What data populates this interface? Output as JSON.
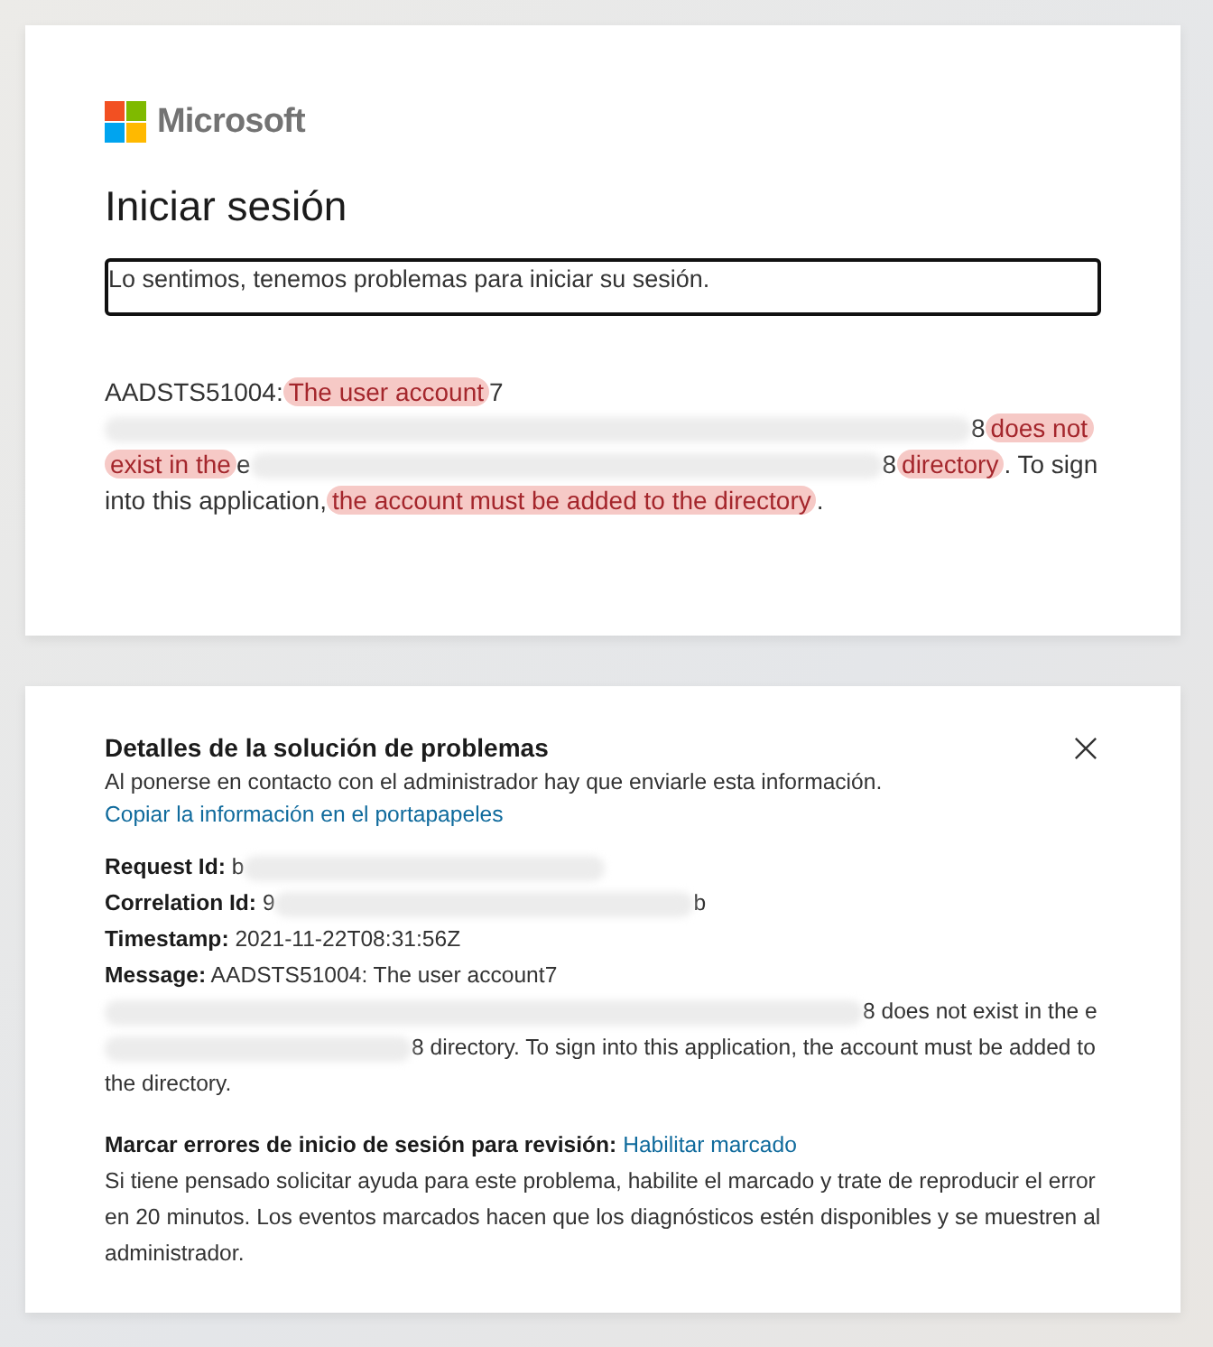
{
  "signin_card": {
    "logo_text": "Microsoft",
    "title": "Iniciar sesión",
    "alert": "Lo sentimos, tenemos problemas para iniciar su sesión.",
    "message": [
      {
        "kind": "plain",
        "text": "AADSTS51004:"
      },
      {
        "kind": "highlight",
        "text": "The user account"
      },
      {
        "kind": "plain",
        "text": "7"
      },
      {
        "kind": "redacted"
      },
      {
        "kind": "plain",
        "text": "8"
      },
      {
        "kind": "highlight",
        "text": "does not exist in the"
      },
      {
        "kind": "plain",
        "text": "e"
      },
      {
        "kind": "redacted"
      },
      {
        "kind": "plain",
        "text": "8"
      },
      {
        "kind": "highlight",
        "text": "directory"
      },
      {
        "kind": "plain",
        "text": ". To sign into this application,"
      },
      {
        "kind": "highlight",
        "text": "the account must be added to the directory"
      },
      {
        "kind": "plain",
        "text": "."
      }
    ]
  },
  "details_card": {
    "title": "Detalles de la solución de problemas",
    "subtitle": "Al ponerse en contacto con el administrador hay que enviarle esta información.",
    "copy_link": "Copiar la información en el portapapeles",
    "fields": [
      {
        "label": "Request Id:",
        "value": [
          {
            "kind": "plain",
            "text": "b"
          },
          {
            "kind": "redacted"
          }
        ]
      },
      {
        "label": "Correlation Id:",
        "value": [
          {
            "kind": "plain",
            "text": "9"
          },
          {
            "kind": "redacted"
          },
          {
            "kind": "plain",
            "text": "b"
          }
        ]
      },
      {
        "label": "Timestamp:",
        "value": [
          {
            "kind": "plain",
            "text": "2021-11-22T08:31:56Z"
          }
        ]
      },
      {
        "label": "Message:",
        "value": [
          {
            "kind": "plain",
            "text": "AADSTS51004: The user account"
          },
          {
            "kind": "plain",
            "text": "7"
          },
          {
            "kind": "redacted"
          },
          {
            "kind": "plain",
            "text": "8 does not exist in the e"
          },
          {
            "kind": "redacted"
          },
          {
            "kind": "plain",
            "text": "8 directory. To sign into this application, the account must be added to the directory."
          }
        ]
      }
    ],
    "flag_label": "Marcar errores de inicio de sesión para revisión:",
    "flag_link": "Habilitar marcado",
    "flag_text": "Si tiene pensado solicitar ayuda para este problema, habilite el marcado y trate de reproducir el error en 20 minutos. Los eventos marcados hacen que los diagnósticos estén disponibles y se muestren al administrador."
  }
}
